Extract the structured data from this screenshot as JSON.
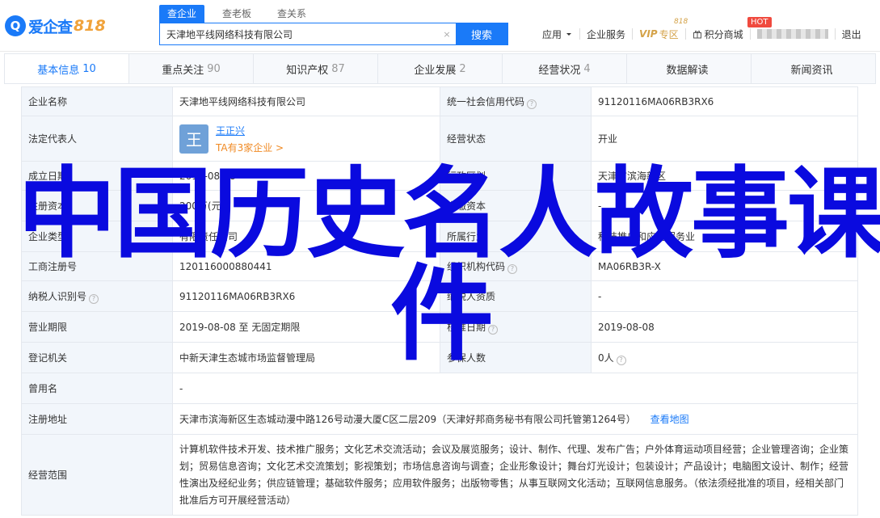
{
  "header": {
    "logo_mark": "Q",
    "logo_text": "爱企查",
    "logo_num": "818",
    "search_tabs": [
      "查企业",
      "查老板",
      "查关系"
    ],
    "search_value": "天津地平线网络科技有限公司",
    "search_clear": "×",
    "search_button": "搜索",
    "nav": {
      "apply": "应用",
      "enterprise_service": "企业服务",
      "vip_mini": "818",
      "vip": "VIP",
      "vip_sub": "专区",
      "points_mall": "积分商城",
      "hot": "HOT",
      "logout": "退出"
    }
  },
  "subtabs": [
    {
      "label": "基本信息",
      "count": "10"
    },
    {
      "label": "重点关注",
      "count": "90"
    },
    {
      "label": "知识产权",
      "count": "87"
    },
    {
      "label": "企业发展",
      "count": "2"
    },
    {
      "label": "经营状况",
      "count": "4"
    },
    {
      "label": "数据解读",
      "count": ""
    },
    {
      "label": "新闻资讯",
      "count": ""
    }
  ],
  "table": {
    "company_name_label": "企业名称",
    "company_name": "天津地平线网络科技有限公司",
    "credit_code_label": "统一社会信用代码",
    "credit_code": "91120116MA06RB3RX6",
    "legal_rep_label": "法定代表人",
    "legal_rep_avatar": "王",
    "legal_rep_name": "王正兴",
    "legal_rep_sub": "TA有3家企业 >",
    "status_label": "经营状态",
    "status": "开业",
    "founded_label": "成立日期",
    "founded": "2019-08-08",
    "region_label": "行政区划",
    "region": "天津市滨海新区",
    "capital_label": "注册资本",
    "capital": "200万(元)",
    "paid_capital_label": "实缴资本",
    "paid_capital": "-",
    "type_label": "企业类型",
    "type": "有限责任公司",
    "industry_label": "所属行业",
    "industry": "科技推广和应用服务业",
    "reg_no_label": "工商注册号",
    "reg_no": "120116000880441",
    "org_code_label": "组织机构代码",
    "org_code": "MA06RB3R-X",
    "taxpayer_label": "纳税人识别号",
    "taxpayer": "91120116MA06RB3RX6",
    "taxpayer_qual_label": "纳税人资质",
    "taxpayer_qual": "-",
    "term_label": "营业期限",
    "term": "2019-08-08 至 无固定期限",
    "approve_label": "核准日期",
    "approve": "2019-08-08",
    "authority_label": "登记机关",
    "authority": "中新天津生态城市场监督管理局",
    "insured_label": "参保人数",
    "insured": "0人",
    "former_label": "曾用名",
    "former": "-",
    "address_label": "注册地址",
    "address": "天津市滨海新区生态城动漫中路126号动漫大厦C区二层209（天津好邦商务秘书有限公司托管第1264号）",
    "map_link": "查看地图",
    "scope_label": "经营范围",
    "scope": "计算机软件技术开发、技术推广服务；文化艺术交流活动；会议及展览服务；设计、制作、代理、发布广告；户外体育运动项目经营；企业管理咨询；企业策划；贸易信息咨询；文化艺术交流策划；影视策划；市场信息咨询与调查；企业形象设计；舞台灯光设计；包装设计；产品设计；电脑图文设计、制作；经营性演出及经纪业务；供应链管理；基础软件服务；应用软件服务；出版物零售；从事互联网文化活动；互联网信息服务。（依法须经批准的项目，经相关部门批准后方可开展经营活动）",
    "help_glyph": "?"
  },
  "overlay": {
    "line1": "中国历史名人故事课",
    "line2": "件"
  }
}
